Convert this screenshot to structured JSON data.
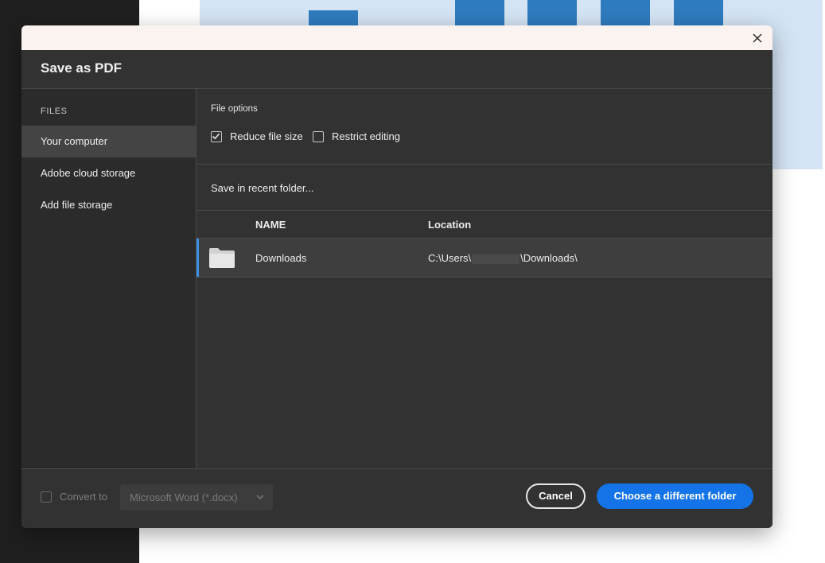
{
  "dialog": {
    "title": "Save as PDF",
    "close_icon": "close-icon"
  },
  "sidebar": {
    "heading": "FILES",
    "items": [
      {
        "label": "Your computer",
        "active": true
      },
      {
        "label": "Adobe cloud storage",
        "active": false
      },
      {
        "label": "Add file storage",
        "active": false
      }
    ]
  },
  "file_options": {
    "label": "File options",
    "reduce_file_size": {
      "label": "Reduce file size",
      "checked": true
    },
    "restrict_editing": {
      "label": "Restrict editing",
      "checked": false
    }
  },
  "recent": {
    "label": "Save in recent folder..."
  },
  "table": {
    "columns": [
      "NAME",
      "Location"
    ],
    "rows": [
      {
        "name": "Downloads",
        "location_prefix": "C:\\Users\\",
        "location_suffix": "\\Downloads\\",
        "icon": "folder-icon",
        "selected": true
      }
    ]
  },
  "footer": {
    "convert_label": "Convert to",
    "convert_checked": false,
    "format_selected": "Microsoft Word (*.docx)",
    "cancel_label": "Cancel",
    "primary_label": "Choose a different folder"
  },
  "colors": {
    "accent": "#1473e6",
    "dialog_bg": "#323232",
    "sidebar_bg": "#2b2b2b",
    "selection_accent": "#3a8ee6"
  }
}
